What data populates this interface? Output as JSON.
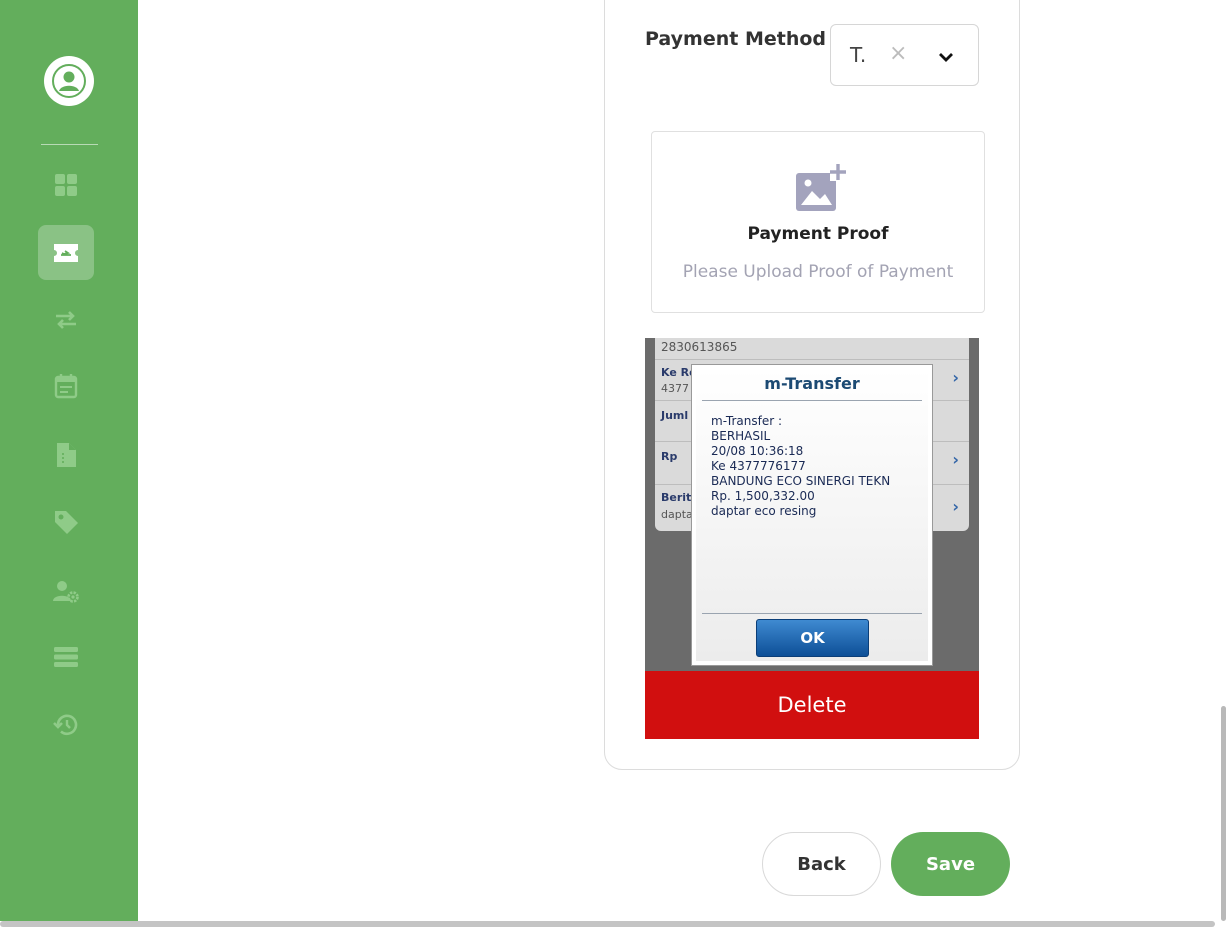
{
  "sidebar": {
    "avatar_icon": "user-circle-icon",
    "items": [
      {
        "icon": "dashboard-icon",
        "active": false
      },
      {
        "icon": "ticket-flight-icon",
        "active": true
      },
      {
        "icon": "transfer-arrows-icon",
        "active": false
      },
      {
        "icon": "calendar-icon",
        "active": false
      },
      {
        "icon": "invoice-document-icon",
        "active": false
      },
      {
        "icon": "tag-icon",
        "active": false
      },
      {
        "icon": "user-settings-icon",
        "active": false
      },
      {
        "icon": "server-list-icon",
        "active": false
      },
      {
        "icon": "history-icon",
        "active": false
      }
    ]
  },
  "payment": {
    "label": "Payment Method",
    "selected_value": "T.",
    "clear_symbol": "×"
  },
  "upload": {
    "icon": "add-image-icon",
    "title": "Payment Proof",
    "hint": "Please Upload Proof of Payment"
  },
  "receipt": {
    "background": {
      "account_number": "2830613865",
      "to_label": "Ke Re",
      "to_value": "4377",
      "amount_label": "Juml",
      "currency_label": "Rp",
      "note_label": "Berita",
      "note_value": "dapta"
    },
    "dialog": {
      "title": "m-Transfer",
      "lines": [
        "m-Transfer :",
        "BERHASIL",
        "20/08 10:36:18",
        "Ke 4377776177",
        "BANDUNG ECO SINERGI TEKN",
        "Rp. 1,500,332.00",
        "daptar eco resing"
      ],
      "ok_label": "OK"
    }
  },
  "actions": {
    "delete_label": "Delete",
    "back_label": "Back",
    "save_label": "Save"
  },
  "colors": {
    "brand_green": "#63ae5c",
    "delete_red": "#d10f0f"
  }
}
